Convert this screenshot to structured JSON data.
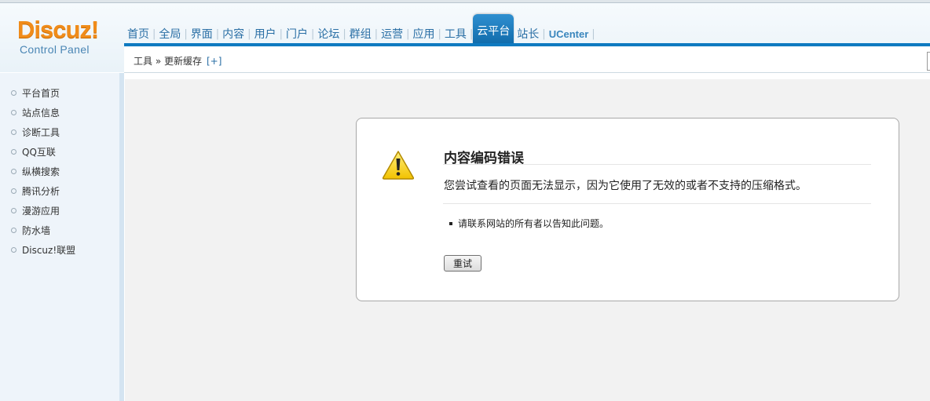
{
  "logo": {
    "brand": "Discuz!",
    "subtitle": "Control Panel"
  },
  "nav": {
    "items": [
      "首页",
      "全局",
      "界面",
      "内容",
      "用户",
      "门户",
      "论坛",
      "群组",
      "运营",
      "应用",
      "工具"
    ],
    "active": "云平台",
    "after": [
      "站长"
    ],
    "ucenter": "UCenter"
  },
  "breadcrumb": {
    "path": "工具 » 更新缓存",
    "add": "[+]"
  },
  "sidebar": {
    "items": [
      "平台首页",
      "站点信息",
      "诊断工具",
      "QQ互联",
      "纵横搜索",
      "腾讯分析",
      "漫游应用",
      "防水墙",
      "Discuz!联盟"
    ]
  },
  "error": {
    "title": "内容编码错误",
    "description": "您尝试查看的页面无法显示，因为它使用了无效的或者不支持的压缩格式。",
    "bullet": "请联系网站的所有者以告知此问题。",
    "retry_label": "重试"
  },
  "colors": {
    "accent": "#0e7ac0",
    "logo": "#f08c1a",
    "link": "#2a6fa5"
  },
  "icons": {
    "warning": "warning-icon"
  }
}
